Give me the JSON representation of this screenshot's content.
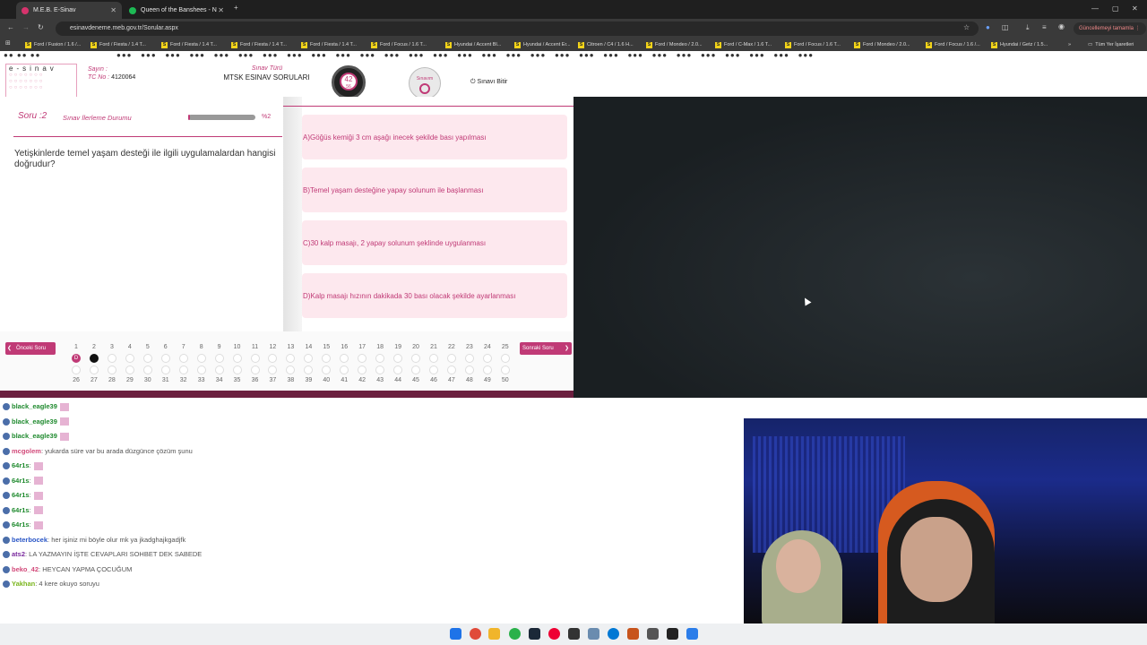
{
  "browser": {
    "tabs": [
      {
        "title": "M.E.B. E-Sinav",
        "active": true
      },
      {
        "title": "Queen of the Banshees - N",
        "active": false
      }
    ],
    "url": "esinavdeneme.meb.gov.tr/Sorular.aspx",
    "update_label": "Güncellemeyi tamamla",
    "bookmarks": [
      "Ford / Fusion / 1.6 /...",
      "Ford / Fiesta / 1.4 T...",
      "Ford / Fiesta / 1.4 T...",
      "Ford / Fiesta / 1.4 T...",
      "Ford / Fiesta / 1.4 T...",
      "Ford / Focus / 1.6 T...",
      "Hyundai / Accent Bl...",
      "Hyundai / Accent Er...",
      "Citroen / C4 / 1.6 H...",
      "Ford / Mondeo / 2.0...",
      "Ford / C-Max / 1.6 T...",
      "Ford / Focus / 1.6 T...",
      "Ford / Mondeo / 2.0...",
      "Ford / Focus / 1.6 /...",
      "Hyundai / Getz / 1.5..."
    ],
    "all_bookmarks": "Tüm Yer İşaretleri"
  },
  "exam": {
    "logo_letters": "e-sinav",
    "sayin_label": "Sayın :",
    "tc_label": "TC No :",
    "tc_value": "4120064",
    "sinav_turu_label": "Sınav Türü",
    "sinav_turu_value": "MTSK ESINAV SORULARI",
    "timer_value": "42",
    "timer_sub": "56",
    "sinavim_label": "Sınavım",
    "finish_label": "Sınavı Bitir",
    "question_label": "Soru :2",
    "progress_label": "Sınav İlerleme Durumu",
    "progress_value": "%2",
    "progress_fraction": 0.02,
    "question_text": "Yetişkinlerde temel yaşam desteği ile ilgili uygulamalardan hangisi doğrudur?",
    "options": [
      "A)Göğüs kemiği 3 cm aşağı inecek şekilde bası yapılması",
      "B)Temel yaşam desteğine yapay solunum ile başlanması",
      "C)30 kalp masajı, 2 yapay solunum şeklinde uygulanması",
      "D)Kalp masajı hızının dakikada 30 bası olacak şekilde ayarlanması"
    ],
    "prev_label": "Önceki Soru",
    "next_label": "Sonraki Soru",
    "row1_numbers": [
      "1",
      "2",
      "3",
      "4",
      "5",
      "6",
      "7",
      "8",
      "9",
      "10",
      "11",
      "12",
      "13",
      "14",
      "15",
      "16",
      "17",
      "18",
      "19",
      "20",
      "21",
      "22",
      "23",
      "24",
      "25"
    ],
    "row2_numbers": [
      "26",
      "27",
      "28",
      "29",
      "30",
      "31",
      "32",
      "33",
      "34",
      "35",
      "36",
      "37",
      "38",
      "39",
      "40",
      "41",
      "42",
      "43",
      "44",
      "45",
      "46",
      "47",
      "48",
      "49",
      "50"
    ],
    "answered_mark": "D"
  },
  "chat": [
    {
      "user": "black_eagle39",
      "color": "#1f8a2e",
      "text": ""
    },
    {
      "user": "black_eagle39",
      "color": "#1f8a2e",
      "text": ""
    },
    {
      "user": "black_eagle39",
      "color": "#1f8a2e",
      "text": ""
    },
    {
      "user": "mcgolem",
      "color": "#d24a7a",
      "text": ": yukarda süre var bu arada düzgünce çözüm şunu"
    },
    {
      "user": "64r1s",
      "color": "#1f8a2e",
      "text": ":"
    },
    {
      "user": "64r1s",
      "color": "#1f8a2e",
      "text": ":"
    },
    {
      "user": "64r1s",
      "color": "#1f8a2e",
      "text": ":"
    },
    {
      "user": "64r1s",
      "color": "#1f8a2e",
      "text": ":"
    },
    {
      "user": "64r1s",
      "color": "#1f8a2e",
      "text": ":"
    },
    {
      "user": "beterbocek",
      "color": "#2a56c6",
      "text": ": her işiniz mi böyle olur mk ya jkadghajkgadjfk"
    },
    {
      "user": "ats2",
      "color": "#7a2a9e",
      "text": ": LA YAZMAYIN İŞTE CEVAPLARI SOHBET DEK SABEDE"
    },
    {
      "user": "beko_42",
      "color": "#d24a7a",
      "text": ": HEYCAN YAPMA ÇOCUĞUM"
    },
    {
      "user": "Yakhan",
      "color": "#7ab51d",
      "text": ": 4 kere okuyo soruyu"
    }
  ],
  "colors": {
    "accent": "#c03a76",
    "option_bg": "#fde8ee",
    "dark_bg": "#1e2427"
  }
}
